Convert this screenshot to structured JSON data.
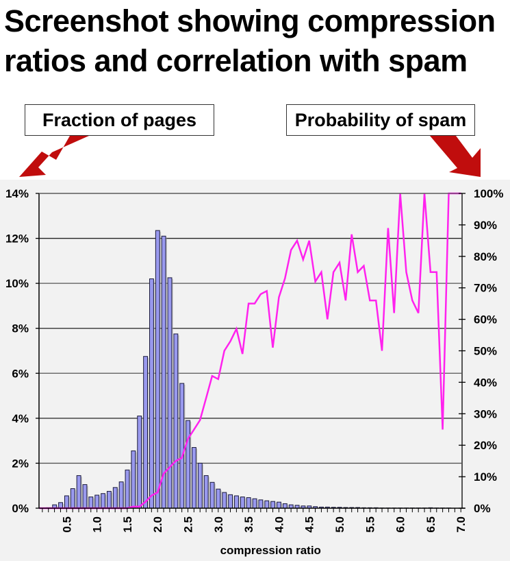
{
  "slide": {
    "title_line1": "Screenshot showing compression",
    "title_line2": "ratios and correlation with spam",
    "callout_left": "Fraction of pages",
    "callout_right": "Probability of spam",
    "arrow_color": "#c00d0d"
  },
  "chart_data": {
    "type": "bar+line",
    "title": "",
    "xlabel": "compression ratio",
    "ylabel_left": "Fraction of pages",
    "ylabel_right": "Probability of spam",
    "x_range": [
      0.0,
      7.0
    ],
    "x_ticks": [
      "0.5",
      "1.0",
      "1.5",
      "2.0",
      "2.5",
      "3.0",
      "3.5",
      "4.0",
      "4.5",
      "5.0",
      "5.5",
      "6.0",
      "6.5",
      "7.0"
    ],
    "ylim_left": [
      0,
      14
    ],
    "yticks_left": [
      "0%",
      "2%",
      "4%",
      "6%",
      "8%",
      "10%",
      "12%",
      "14%"
    ],
    "ylim_right": [
      0,
      100
    ],
    "yticks_right": [
      "0%",
      "10%",
      "20%",
      "30%",
      "40%",
      "50%",
      "60%",
      "70%",
      "80%",
      "90%",
      "100%"
    ],
    "grid": true,
    "colors": {
      "bars": "#9999ee",
      "bar_border": "#1a1a3a",
      "line": "#ff22ee",
      "plot_bg": "#f2f2f2",
      "grid": "#000000"
    },
    "series": [
      {
        "name": "Fraction of pages",
        "kind": "bar",
        "axis": "left",
        "x": [
          0.1,
          0.2,
          0.3,
          0.4,
          0.5,
          0.6,
          0.7,
          0.8,
          0.9,
          1.0,
          1.1,
          1.2,
          1.3,
          1.4,
          1.5,
          1.6,
          1.7,
          1.8,
          1.9,
          2.0,
          2.1,
          2.2,
          2.3,
          2.4,
          2.5,
          2.6,
          2.7,
          2.8,
          2.9,
          3.0,
          3.1,
          3.2,
          3.3,
          3.4,
          3.5,
          3.6,
          3.7,
          3.8,
          3.9,
          4.0,
          4.1,
          4.2,
          4.3,
          4.4,
          4.5,
          4.6,
          4.7,
          4.8,
          4.9,
          5.0,
          5.1,
          5.2,
          5.3,
          5.4,
          5.5,
          5.6,
          5.7,
          5.8,
          5.9,
          6.0,
          6.1,
          6.2,
          6.3,
          6.4,
          6.5,
          6.6,
          6.7,
          6.8,
          6.9
        ],
        "values": [
          0.0,
          0.02,
          0.15,
          0.25,
          0.55,
          0.87,
          1.45,
          1.05,
          0.5,
          0.58,
          0.65,
          0.75,
          0.92,
          1.17,
          1.7,
          2.55,
          4.1,
          6.75,
          10.2,
          12.35,
          12.1,
          10.25,
          7.75,
          5.55,
          3.9,
          2.7,
          2.0,
          1.45,
          1.15,
          0.85,
          0.7,
          0.6,
          0.55,
          0.5,
          0.47,
          0.42,
          0.37,
          0.33,
          0.3,
          0.27,
          0.2,
          0.15,
          0.13,
          0.1,
          0.1,
          0.07,
          0.05,
          0.05,
          0.04,
          0.04,
          0.03,
          0.03,
          0.03,
          0.02,
          0.02,
          0.02,
          0.01,
          0.01,
          0.01,
          0.01,
          0.01,
          0.01,
          0.01,
          0.01,
          0.02,
          0.01,
          0.01,
          0.01,
          0.0
        ]
      },
      {
        "name": "Probability of spam",
        "kind": "line",
        "axis": "right",
        "x": [
          0.05,
          0.1,
          0.2,
          0.3,
          0.4,
          0.5,
          0.6,
          0.7,
          0.8,
          0.9,
          1.0,
          1.1,
          1.2,
          1.3,
          1.4,
          1.5,
          1.6,
          1.7,
          1.8,
          1.9,
          2.0,
          2.1,
          2.2,
          2.3,
          2.4,
          2.5,
          2.6,
          2.7,
          2.8,
          2.9,
          3.0,
          3.1,
          3.2,
          3.3,
          3.4,
          3.5,
          3.6,
          3.7,
          3.8,
          3.9,
          4.0,
          4.1,
          4.2,
          4.3,
          4.4,
          4.5,
          4.6,
          4.7,
          4.8,
          4.9,
          5.0,
          5.1,
          5.2,
          5.3,
          5.4,
          5.5,
          5.6,
          5.7,
          5.8,
          5.9,
          6.0,
          6.1,
          6.2,
          6.3,
          6.4,
          6.5,
          6.6,
          6.7,
          6.8,
          6.9,
          7.0
        ],
        "values": [
          0,
          0,
          0,
          0,
          0,
          0,
          0,
          0,
          0,
          0,
          0,
          0,
          0,
          0,
          0,
          0,
          0.5,
          0.5,
          2,
          4,
          5,
          11,
          13,
          15,
          16,
          22,
          25,
          28,
          35,
          42,
          41,
          50,
          53,
          57,
          49,
          65,
          65,
          68,
          69,
          51,
          67,
          73,
          82,
          85,
          79,
          85,
          72,
          75,
          60,
          75,
          78,
          66,
          87,
          75,
          77,
          66,
          66,
          50,
          89,
          62,
          100,
          75,
          66,
          62,
          100,
          75,
          75,
          25,
          100,
          100,
          100
        ]
      }
    ]
  }
}
